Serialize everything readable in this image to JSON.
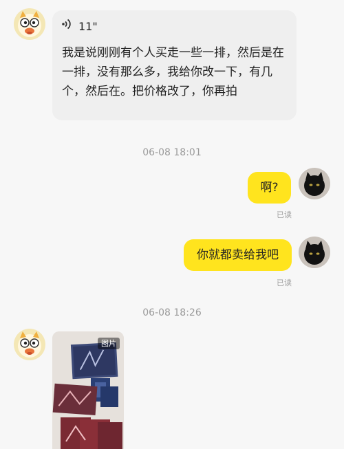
{
  "messages": {
    "voice": {
      "duration": "11\"",
      "transcript": "我是说刚刚有个人买走一些一排，然后是在一排，没有那么多，我给你改一下，有几个，然后在。把价格改了，你再拍"
    },
    "ts1": "06-08 18:01",
    "out1": {
      "text": "啊?",
      "status": "已读"
    },
    "out2": {
      "text": "你就都卖给我吧",
      "status": "已读"
    },
    "ts2": "06-08 18:26",
    "image": {
      "tag": "图片"
    }
  },
  "icons": {
    "contact_avatar": "cartoon-cat-avatar",
    "own_avatar": "black-cat-avatar",
    "voice": "sound-wave-icon"
  },
  "colors": {
    "outgoing_bubble": "#ffe41e",
    "incoming_bubble": "#efefef",
    "background": "#f7f7f7"
  }
}
